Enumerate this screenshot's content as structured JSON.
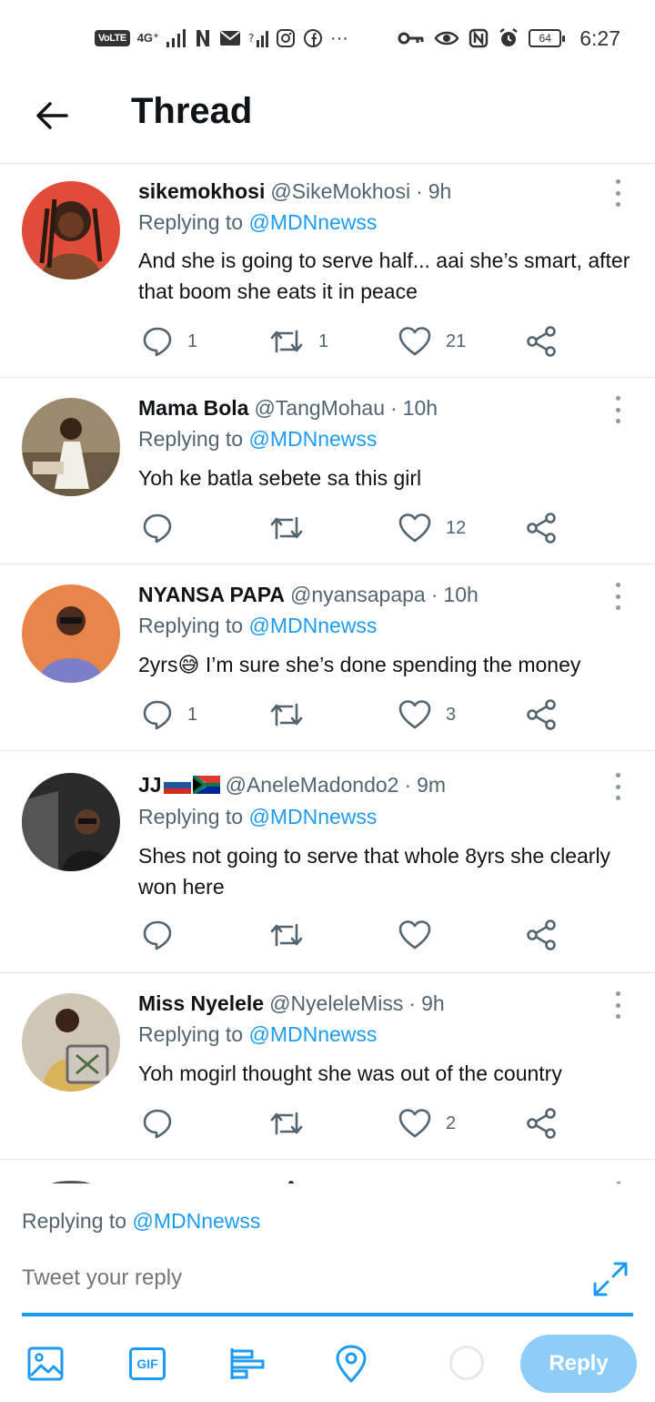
{
  "status_bar": {
    "network_badge": "VoLTE",
    "network_type": "4G⁺",
    "battery": "64",
    "time": "6:27"
  },
  "header": {
    "title": "Thread"
  },
  "colors": {
    "accent": "#1d9bf0",
    "text": "#0f1419",
    "secondary": "#536471",
    "divider": "#e6e9ec",
    "reply_button": "#8ecdf8"
  },
  "tweets": [
    {
      "name": "sikemokhosi",
      "handle": "@SikeMokhosi",
      "time": "9h",
      "replying_prefix": "Replying to",
      "replying_to": "@MDNnewss",
      "text": "And she is going to serve half... aai she’s smart, after that boom she eats it in peace",
      "replies": "1",
      "retweets": "1",
      "likes": "21"
    },
    {
      "name": "Mama Bola",
      "handle": "@TangMohau",
      "time": "10h",
      "replying_prefix": "Replying to",
      "replying_to": "@MDNnewss",
      "text": "Yoh ke batla sebete sa this girl",
      "replies": "",
      "retweets": "",
      "likes": "12"
    },
    {
      "name": "NYANSA PAPA",
      "handle": "@nyansapapa",
      "time": "10h",
      "replying_prefix": "Replying to",
      "replying_to": "@MDNnewss",
      "text": "2yrs😅 I’m sure she’s done spending the money",
      "replies": "1",
      "retweets": "",
      "likes": "3"
    },
    {
      "name": "JJ",
      "handle": "@AneleMadondo2",
      "time": "9m",
      "replying_prefix": "Replying to",
      "replying_to": "@MDNnewss",
      "text": "Shes not going to serve that whole 8yrs she clearly won here",
      "replies": "",
      "retweets": "",
      "likes": ""
    },
    {
      "name": "Miss Nyelele",
      "handle": "@NyeleleMiss",
      "time": "9h",
      "replying_prefix": "Replying to",
      "replying_to": "@MDNnewss",
      "text": "Yoh mogirl thought she was out of the country",
      "replies": "",
      "retweets": "",
      "likes": "2"
    }
  ],
  "composer": {
    "replying_prefix": "Replying to",
    "replying_to": "@MDNnewss",
    "placeholder": "Tweet your reply",
    "reply_button": "Reply"
  },
  "icons": [
    "back-arrow-icon",
    "more-icon",
    "reply-icon",
    "retweet-icon",
    "like-icon",
    "share-icon",
    "expand-icon",
    "image-icon",
    "gif-icon",
    "poll-icon",
    "location-icon"
  ]
}
